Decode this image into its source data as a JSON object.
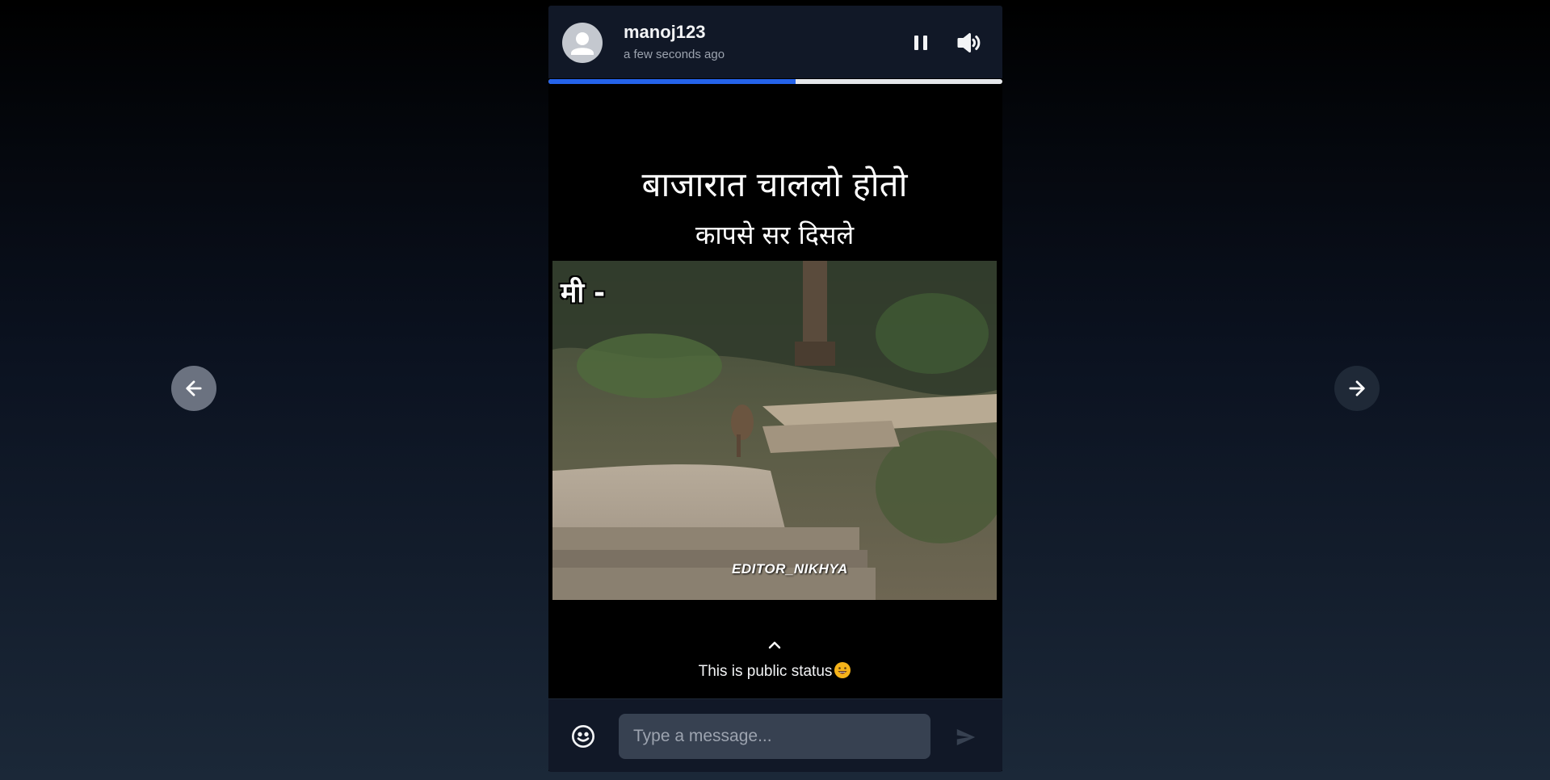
{
  "header": {
    "username": "manoj123",
    "timestamp": "a few seconds ago",
    "pause_icon": "pause-icon",
    "volume_icon": "volume-icon"
  },
  "progress": {
    "fraction": 0.545,
    "fill_color": "#2563eb",
    "track_color": "#e5e7eb"
  },
  "media": {
    "caption_line1": "बाजारात चाललो होतो",
    "caption_line2": "कापसे सर दिसले",
    "overlay_label": "मी -",
    "watermark": "EDITOR_NIKHYA"
  },
  "status": {
    "text": "This is public status",
    "emoji_icon": "grinning-face-icon",
    "expand_icon": "chevron-up-icon"
  },
  "composer": {
    "placeholder": "Type a message...",
    "emoji_icon": "smiley-icon",
    "send_icon": "send-icon"
  },
  "navigation": {
    "prev_icon": "arrow-left-icon",
    "next_icon": "arrow-right-icon"
  }
}
